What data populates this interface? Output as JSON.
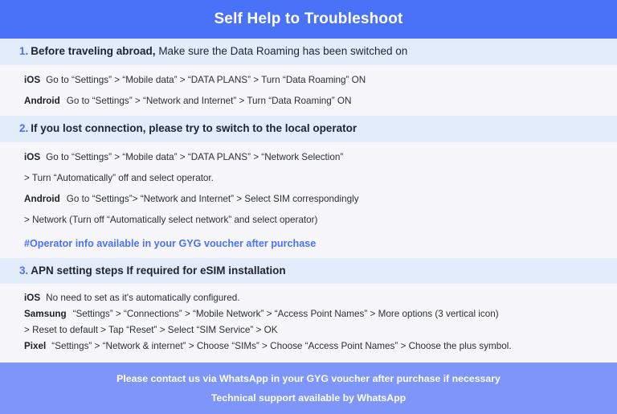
{
  "header": {
    "title": "Self Help to Troubleshoot",
    "background_color": "#4a72f8",
    "text_color": "#ffffff"
  },
  "colors": {
    "accent_blue": "#4a72f8",
    "section_head_band": "#e3ecfb",
    "body_background": "#f6f6fb",
    "footer_background": "#7e96f9",
    "body_text": "#2b2f38"
  },
  "sections": [
    {
      "number": "1.",
      "heading_lead": "Before traveling abroad,",
      "heading_rest": " Make sure the Data Roaming has been switched on",
      "lines": [
        {
          "platform": "iOS",
          "text": "Go to “Settings” > “Mobile data” > “DATA PLANS” > Turn “Data Roaming” ON"
        },
        {
          "platform": "Android",
          "text": "Go to “Settings” > “Network and Internet” > Turn “Data Roaming” ON"
        }
      ],
      "note": ""
    },
    {
      "number": "2.",
      "heading_lead": "If you lost connection, please try to switch to the local operator",
      "heading_rest": "",
      "lines": [
        {
          "platform": "iOS",
          "text": "Go to “Settings” > “Mobile data” > “DATA PLANS” > “Network Selection”"
        },
        {
          "platform": "",
          "text": "> Turn “Automatically” off and select operator."
        },
        {
          "platform": "Android",
          "text": "Go to “Settings”>  “Network and Internet” > Select SIM correspondingly"
        },
        {
          "platform": "",
          "text": "> Network (Turn off “Automatically select network” and select operator)"
        }
      ],
      "note": "#Operator info available in your GYG voucher after purchase"
    },
    {
      "number": "3.",
      "heading_lead": "APN setting steps If required for eSIM installation",
      "heading_rest": "",
      "lines": [
        {
          "platform": "iOS",
          "text": "No need to set as it's automatically configured."
        },
        {
          "platform": "Samsung",
          "text": "“Settings” > “Connections” > “Mobile Network” > “Access Point Names” > More options (3 vertical icon)"
        },
        {
          "platform": "",
          "text": "> Reset to default > Tap “Reset” > Select “SIM Service” > OK"
        },
        {
          "platform": "Pixel",
          "text": "“Settings” > “Network & internet” > Choose “SIMs” > Choose “Access Point Names” > Choose the plus symbol."
        }
      ],
      "note": ""
    }
  ],
  "footer": {
    "line1": "Please contact us via WhatsApp  in your GYG voucher after purchase if necessary",
    "line2": "Technical support available by WhatsApp"
  }
}
